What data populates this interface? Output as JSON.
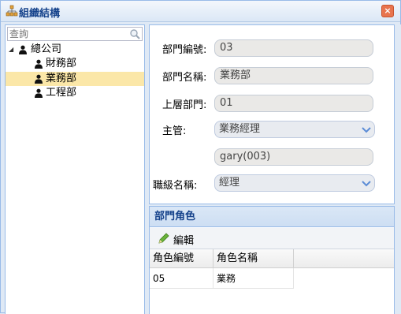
{
  "window": {
    "title": "組織結構",
    "close_glyph": "×"
  },
  "search": {
    "placeholder": "查詢",
    "value": ""
  },
  "tree": {
    "items": [
      {
        "label": "總公司",
        "expanded": true,
        "selected": false
      },
      {
        "label": "財務部",
        "selected": false
      },
      {
        "label": "業務部",
        "selected": true
      },
      {
        "label": "工程部",
        "selected": false
      }
    ]
  },
  "form": {
    "dept_no_label": "部門編號:",
    "dept_no_value": "03",
    "dept_name_label": "部門名稱:",
    "dept_name_value": "業務部",
    "parent_dept_label": "上層部門:",
    "parent_dept_value": "01",
    "manager_label": "主管:",
    "manager_value": "業務經理",
    "manager_account": "gary(003)",
    "title_label": "職級名稱:",
    "title_value": "經理"
  },
  "roles": {
    "header": "部門角色",
    "edit_label": "編輯",
    "columns": [
      "角色編號",
      "角色名稱"
    ],
    "rows": [
      [
        "05",
        "業務"
      ]
    ]
  },
  "colors": {
    "accent": "#15428b",
    "selected_row": "#fbe7a8",
    "border": "#99bbe8"
  }
}
